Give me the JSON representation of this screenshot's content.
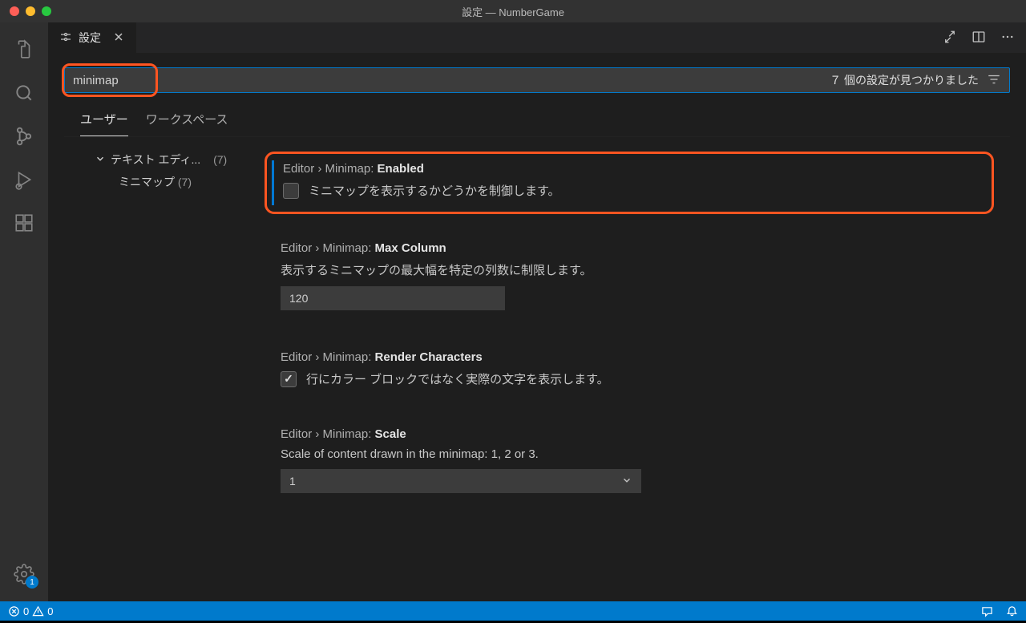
{
  "window": {
    "title": "設定 — NumberGame"
  },
  "tab": {
    "title": "設定"
  },
  "search": {
    "value": "minimap",
    "count_label": "７ 個の設定が見つかりました"
  },
  "scope": {
    "user": "ユーザー",
    "workspace": "ワークスペース"
  },
  "toc": {
    "group": "テキスト エディ...",
    "group_count": "(7)",
    "child": "ミニマップ",
    "child_count": "(7)"
  },
  "settings": {
    "enabled": {
      "prefix": "Editor › Minimap: ",
      "name": "Enabled",
      "desc": "ミニマップを表示するかどうかを制御します。"
    },
    "maxcol": {
      "prefix": "Editor › Minimap: ",
      "name": "Max Column",
      "desc": "表示するミニマップの最大幅を特定の列数に制限します。",
      "value": "120"
    },
    "renderchars": {
      "prefix": "Editor › Minimap: ",
      "name": "Render Characters",
      "desc": "行にカラー ブロックではなく実際の文字を表示します。"
    },
    "scale": {
      "prefix": "Editor › Minimap: ",
      "name": "Scale",
      "desc": "Scale of content drawn in the minimap: 1, 2 or 3.",
      "value": "1"
    }
  },
  "status": {
    "errors": "0",
    "warnings": "0",
    "settings_badge": "1"
  }
}
